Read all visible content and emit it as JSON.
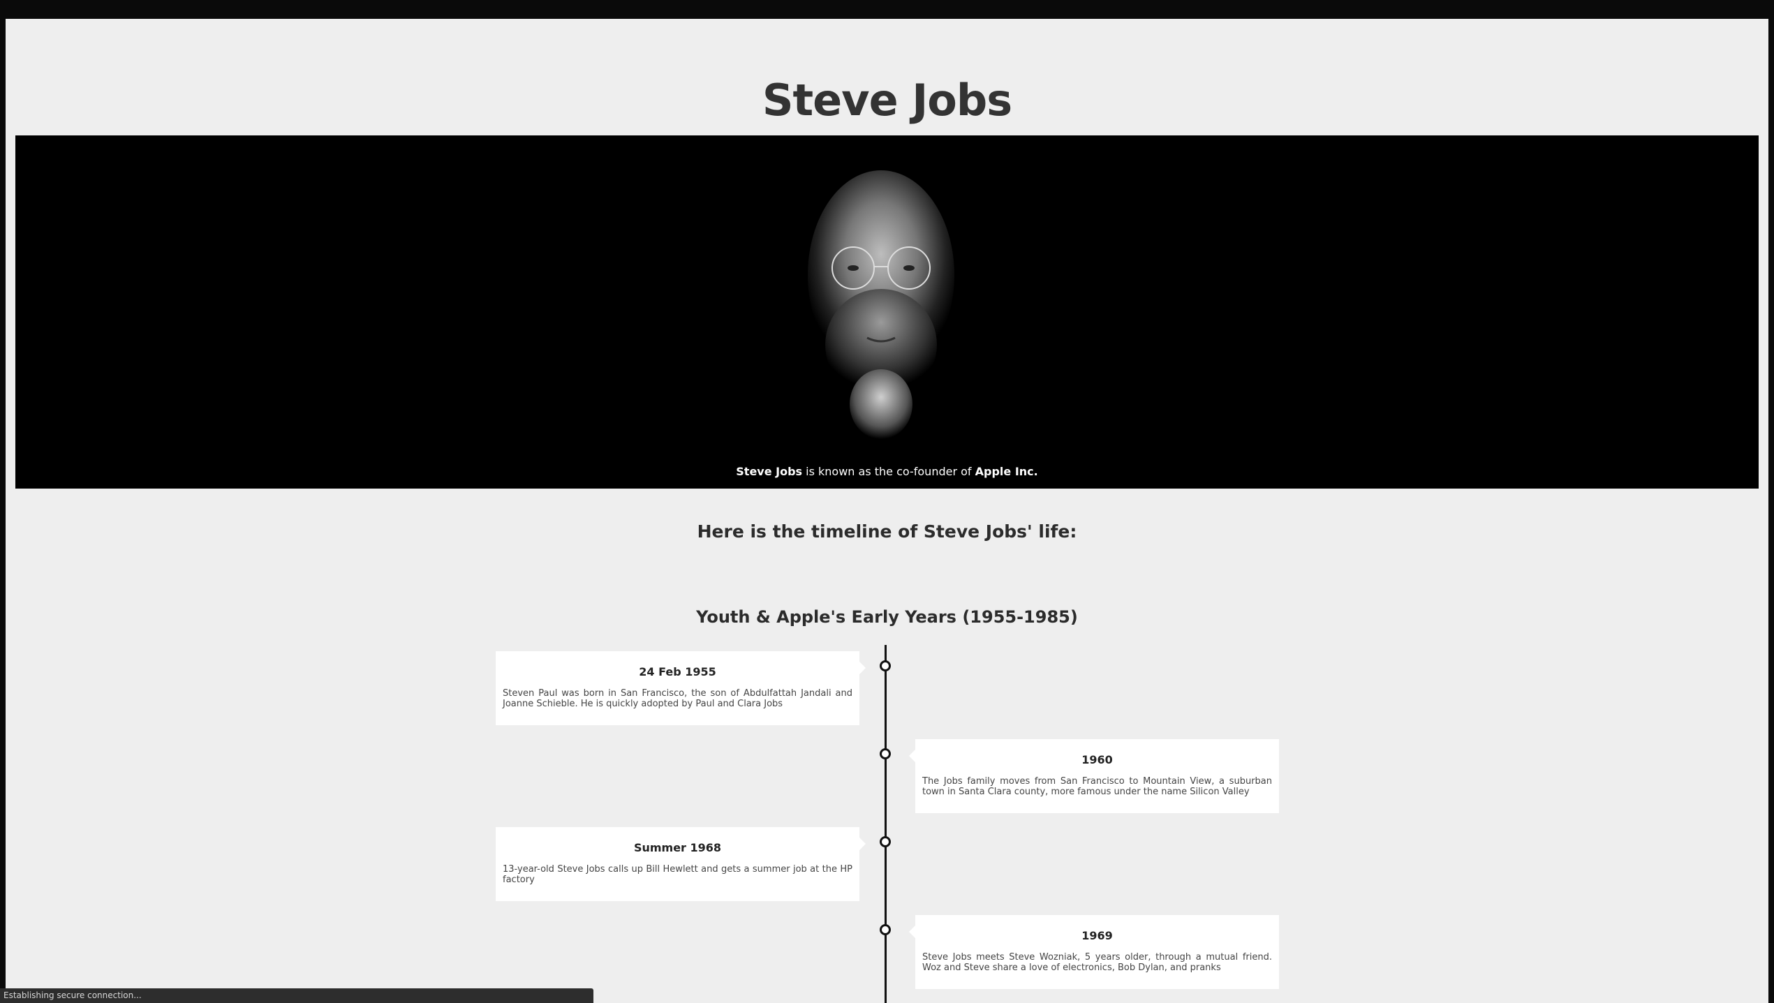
{
  "title": "Steve Jobs",
  "hero": {
    "caption_name": "Steve Jobs",
    "caption_mid": " is known as the co-founder of ",
    "caption_company": "Apple Inc."
  },
  "timeline_intro": "Here is the timeline of Steve Jobs' life:",
  "era": "Youth & Apple's Early Years (1955-1985)",
  "events": [
    {
      "date": "24 Feb 1955",
      "text": "Steven Paul was born in San Francisco, the son of Abdulfattah Jandali and Joanne Schieble. He is quickly adopted by Paul and Clara Jobs"
    },
    {
      "date": "1960",
      "text": "The Jobs family moves from San Francisco to Mountain View, a suburban town in Santa Clara county, more famous under the name Silicon Valley"
    },
    {
      "date": "Summer 1968",
      "text": "13-year-old Steve Jobs calls up Bill Hewlett and gets a summer job at the HP factory"
    },
    {
      "date": "1969",
      "text": "Steve Jobs meets Steve Wozniak, 5 years older, through a mutual friend. Woz and Steve share a love of electronics, Bob Dylan, and pranks"
    }
  ],
  "status": "Establishing secure connection..."
}
